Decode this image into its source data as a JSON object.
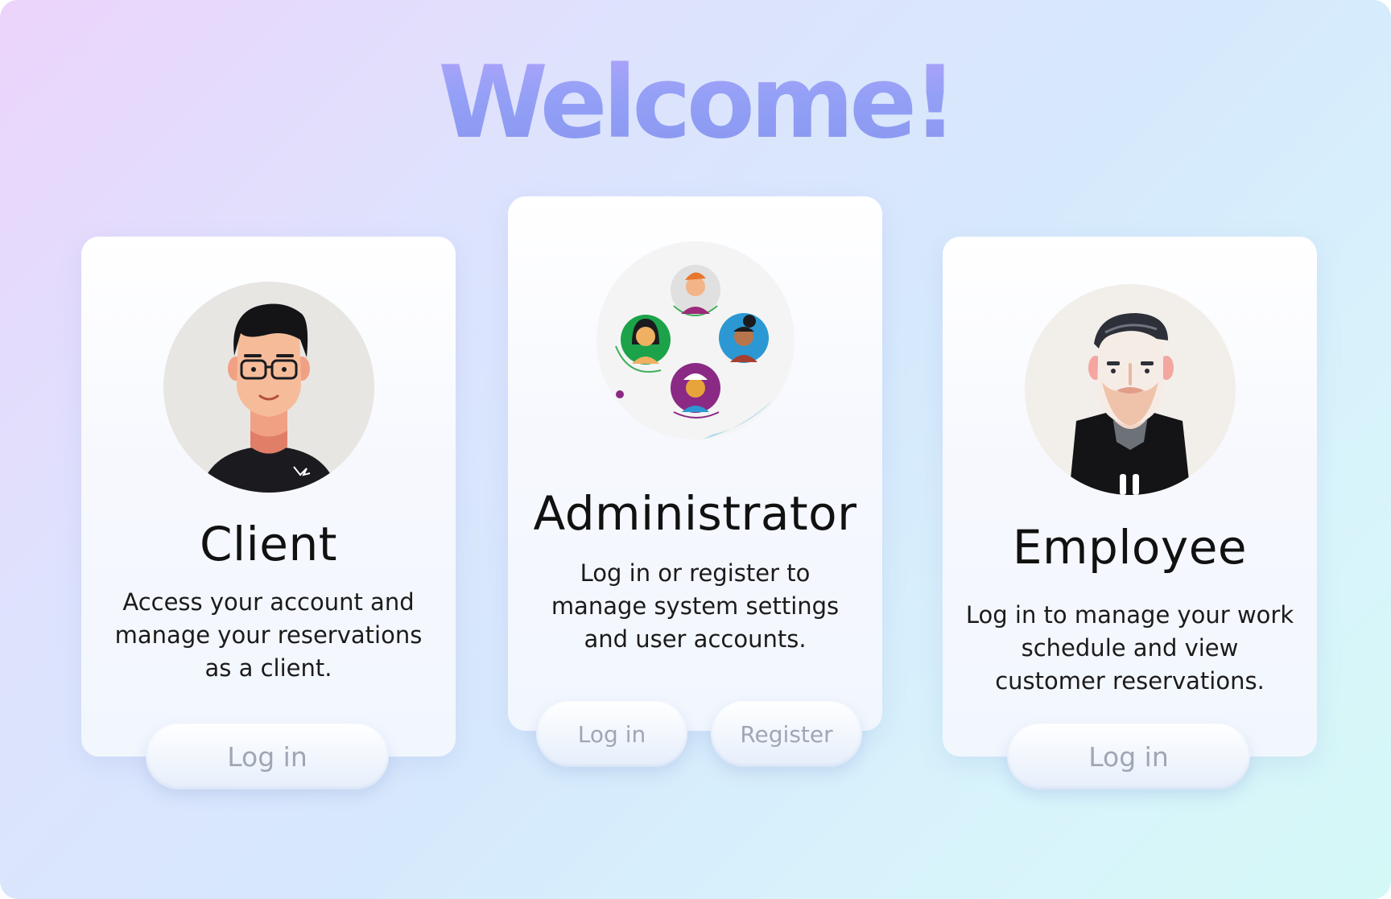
{
  "page": {
    "title": "Welcome!"
  },
  "cards": {
    "client": {
      "title": "Client",
      "description": "Access your account and manage your reservations as a client.",
      "login_label": "Log in",
      "avatar_icon": "young-man-with-glasses-avatar"
    },
    "administrator": {
      "title": "Administrator",
      "description": "Log in or register to manage system settings and user accounts.",
      "login_label": "Log in",
      "register_label": "Register",
      "avatar_icon": "user-network-avatar"
    },
    "employee": {
      "title": "Employee",
      "description": "Log in to manage your work schedule and view customer reservations.",
      "login_label": "Log in",
      "avatar_icon": "bearded-man-avatar"
    }
  },
  "colors": {
    "title_gradient": [
      "#b6a4fb",
      "#8895ee"
    ],
    "button_text": "#9fa6b4",
    "card_title": "#111111"
  }
}
